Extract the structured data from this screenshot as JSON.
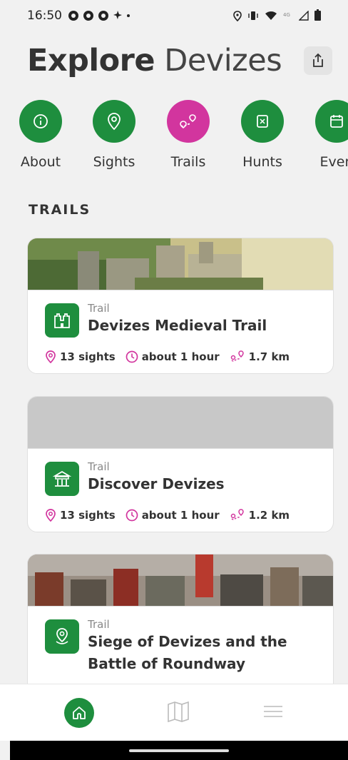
{
  "status": {
    "time": "16:50",
    "left_icons": [
      "notification-icon",
      "notification-icon",
      "notification-icon",
      "fan-icon",
      "dot-icon"
    ],
    "right_icons": [
      "location-icon",
      "vibrate-icon",
      "wifi-icon",
      "4g-icon",
      "signal-icon",
      "battery-icon"
    ]
  },
  "header": {
    "title_bold": "Explore",
    "title_light": "Devizes",
    "share_icon": "share-icon"
  },
  "categories": [
    {
      "label": "About",
      "icon": "info-icon",
      "color": "#1e8e3e"
    },
    {
      "label": "Sights",
      "icon": "pin-icon",
      "color": "#1e8e3e"
    },
    {
      "label": "Trails",
      "icon": "route-icon",
      "color": "#d2359e"
    },
    {
      "label": "Hunts",
      "icon": "map-scroll-icon",
      "color": "#1e8e3e"
    },
    {
      "label": "Even",
      "icon": "calendar-icon",
      "color": "#1e8e3e"
    }
  ],
  "section_title": "TRAILS",
  "trails": [
    {
      "kind": "Trail",
      "name": "Devizes Medieval Trail",
      "sights": "13 sights",
      "duration": "about 1 hour",
      "distance": "1.7 km",
      "icon": "castle-icon"
    },
    {
      "kind": "Trail",
      "name": "Discover Devizes",
      "sights": "13 sights",
      "duration": "about 1 hour",
      "distance": "1.2 km",
      "icon": "building-icon"
    },
    {
      "kind": "Trail",
      "name": "Siege of Devizes and the Battle of Roundway",
      "icon": "pin-icon"
    }
  ],
  "nav": {
    "items": [
      "home-icon",
      "map-icon",
      "menu-icon"
    ]
  },
  "colors": {
    "brand_green": "#1e8e3e",
    "trails_pink": "#d2359e",
    "background": "#f1f1f1"
  }
}
